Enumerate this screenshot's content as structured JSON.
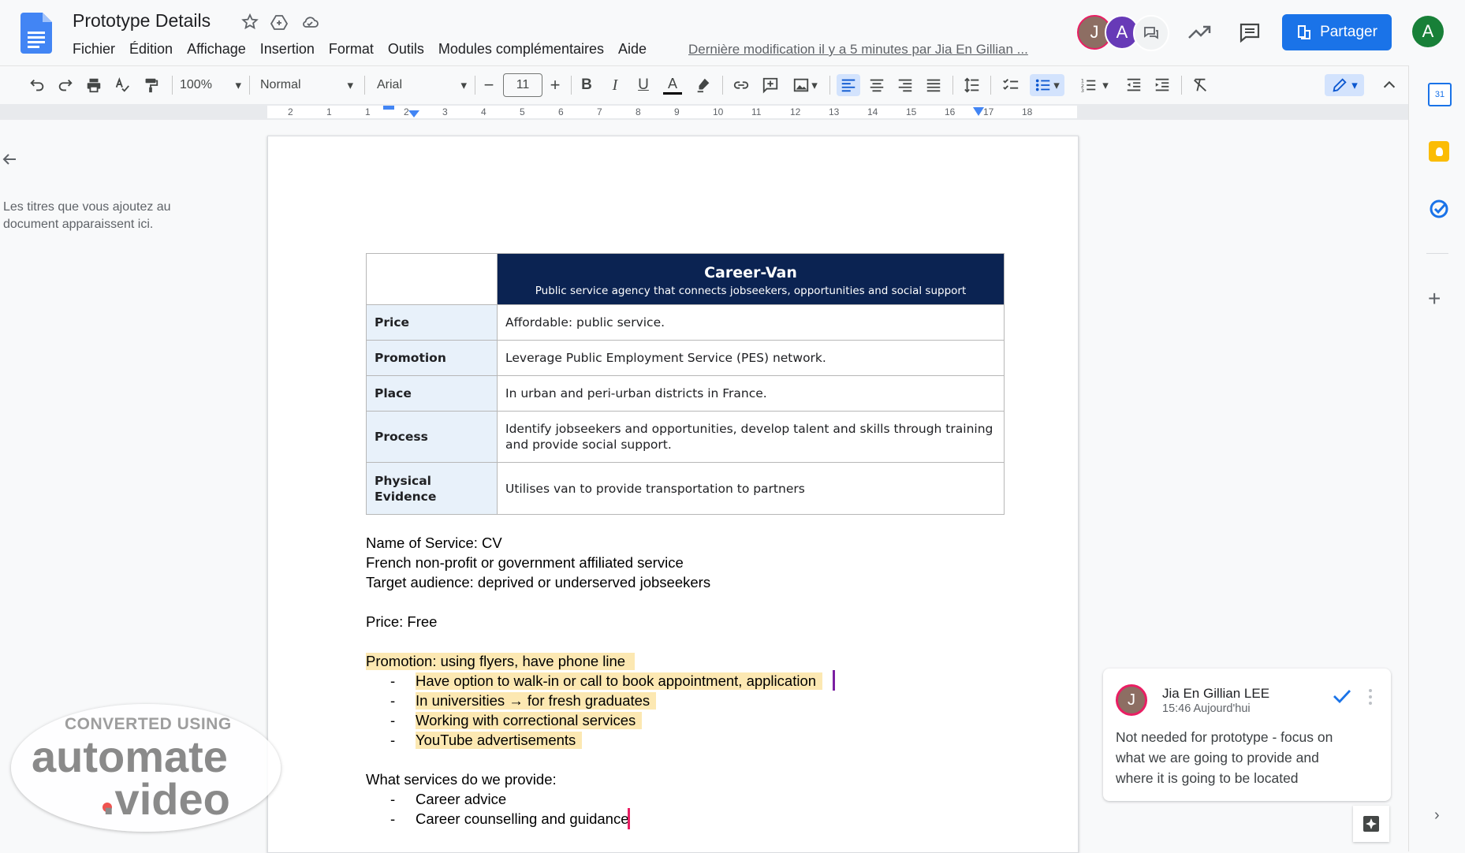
{
  "header": {
    "title": "Prototype Details",
    "menu": [
      "Fichier",
      "Édition",
      "Affichage",
      "Insertion",
      "Format",
      "Outils",
      "Modules complémentaires",
      "Aide"
    ],
    "last_modified": "Dernière modification il y a 5 minutes par Jia En Gillian ...",
    "avatars": [
      "J",
      "A"
    ],
    "share_label": "Partager",
    "account_initial": "A"
  },
  "toolbar": {
    "zoom": "100%",
    "style": "Normal",
    "font": "Arial",
    "font_size": "11"
  },
  "ruler": {
    "ticks": [
      "2",
      "1",
      "1",
      "2",
      "3",
      "4",
      "5",
      "6",
      "7",
      "8",
      "9",
      "10",
      "11",
      "12",
      "13",
      "14",
      "15",
      "16",
      "17",
      "18"
    ]
  },
  "outline": {
    "hint": "Les titres que vous ajoutez au document apparaissent ici."
  },
  "document": {
    "table": {
      "title": "Career-Van",
      "subtitle": "Public service agency that connects jobseekers, opportunities and social support",
      "rows": [
        {
          "label": "Price",
          "value": "Affordable: public service."
        },
        {
          "label": "Promotion",
          "value": "Leverage Public Employment Service (PES) network."
        },
        {
          "label": "Place",
          "value": "In urban and peri-urban districts in France."
        },
        {
          "label": "Process",
          "value": "Identify jobseekers and opportunities, develop talent and skills through training and provide social support."
        },
        {
          "label": "Physical Evidence",
          "value": "Utilises van to provide transportation to partners"
        }
      ]
    },
    "lines": [
      "Name of Service: CV",
      "French non-profit or government affiliated service",
      "Target audience: deprived or underserved jobseekers",
      "Price: Free",
      "Promotion: using flyers, have phone line",
      "What services do we provide:"
    ],
    "promotion_bullets": [
      "Have option to walk-in or call to book appointment, application",
      "In universities → for fresh graduates",
      "Working with correctional services",
      "YouTube advertisements"
    ],
    "services_bullets": [
      "Career advice",
      "Career counselling and guidance"
    ]
  },
  "comment": {
    "author": "Jia En Gillian LEE",
    "author_initial": "J",
    "time": "15:46 Aujourd'hui",
    "text": "Not needed for prototype - focus on what we are going to provide and where it is going to be located"
  },
  "watermark": {
    "line1": "CONVERTED USING",
    "line2": "automate",
    "line3": ".video"
  },
  "colors": {
    "accent": "#1a73e8",
    "table_header": "#0b2352",
    "highlight": "#fce8b2"
  }
}
